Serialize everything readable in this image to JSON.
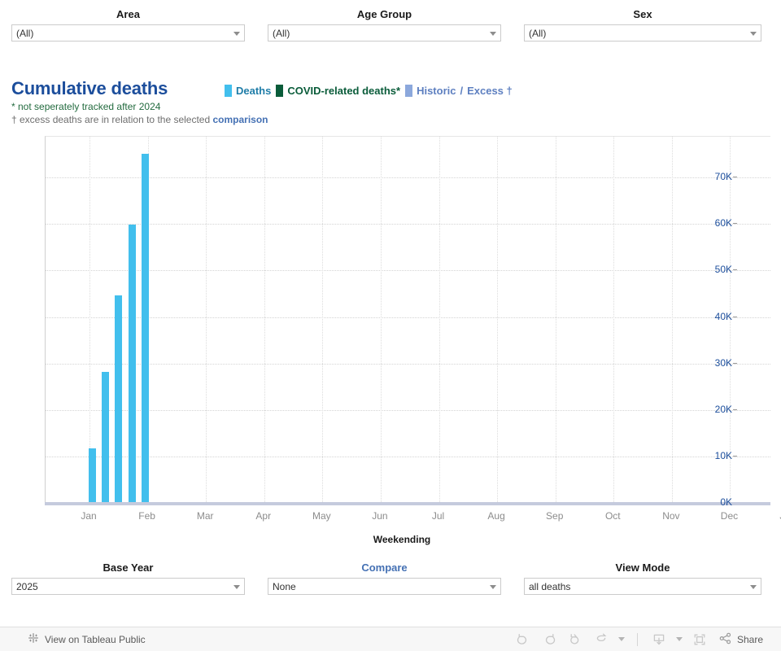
{
  "top_filters": [
    {
      "label": "Area",
      "value": "(All)",
      "label_is_link": false
    },
    {
      "label": "Age Group",
      "value": "(All)",
      "label_is_link": false
    },
    {
      "label": "Sex",
      "value": "(All)",
      "label_is_link": false
    }
  ],
  "bottom_filters": [
    {
      "label": "Base Year",
      "value": "2025",
      "label_is_link": false
    },
    {
      "label": "Compare",
      "value": "None",
      "label_is_link": true
    },
    {
      "label": "View Mode",
      "value": "all deaths",
      "label_is_link": false
    }
  ],
  "title": {
    "heading": "Cumulative deaths",
    "footnote_star": "* not seperately tracked after 2024",
    "footnote_dagger_pre": "† excess deaths are in relation to the selected ",
    "footnote_dagger_link": "comparison"
  },
  "legend": {
    "items": [
      {
        "name": "Deaths",
        "color": "#42bfed",
        "text_color": "#1f7da8"
      },
      {
        "name": "COVID-related deaths*",
        "color": "#0a5c3a",
        "text_color": "#0a5c3a"
      },
      {
        "name": "Historic",
        "color": "#8ca8dc",
        "text_color": "#5d7fc0"
      }
    ],
    "separator": "/",
    "excess_label": "Excess †"
  },
  "chart_data": {
    "type": "bar",
    "title": "Cumulative deaths",
    "xlabel": "Weekending",
    "ylabel": "",
    "ylim": [
      0,
      78800
    ],
    "ytick_values": [
      0,
      10000,
      20000,
      30000,
      40000,
      50000,
      60000,
      70000
    ],
    "ytick_labels": [
      "0K",
      "10K",
      "20K",
      "30K",
      "40K",
      "50K",
      "60K",
      "70K"
    ],
    "xtick_labels": [
      "Jan",
      "Feb",
      "Mar",
      "Apr",
      "May",
      "Jun",
      "Jul",
      "Aug",
      "Sep",
      "Oct",
      "Nov",
      "Dec",
      "Jan"
    ],
    "grid": true,
    "legend_position": "top",
    "series": [
      {
        "name": "Deaths",
        "color": "#42bfed",
        "points": [
          {
            "x": "Jan 4",
            "value": 11600
          },
          {
            "x": "Jan 11",
            "value": 28000
          },
          {
            "x": "Jan 18",
            "value": 44500
          },
          {
            "x": "Jan 25",
            "value": 59800
          },
          {
            "x": "Feb 1",
            "value": 75000
          }
        ]
      }
    ]
  },
  "toolbar": {
    "tableau_public_label": "View on Tableau Public",
    "share_label": "Share",
    "icons": [
      "undo-icon",
      "redo-icon",
      "revert-icon",
      "refresh-icon",
      "pause-icon",
      "download-icon",
      "fullscreen-icon",
      "share-icon"
    ]
  }
}
